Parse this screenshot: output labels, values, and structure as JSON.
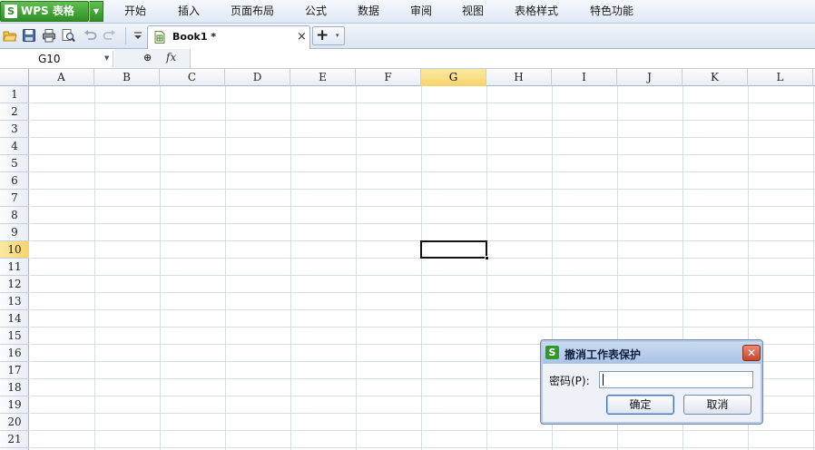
{
  "app": {
    "name": "WPS 表格",
    "logo_letter": "S"
  },
  "menu": {
    "items": [
      "开始",
      "插入",
      "页面布局",
      "公式",
      "数据",
      "审阅",
      "视图",
      "表格样式",
      "特色功能"
    ]
  },
  "toolbar": {
    "icons": [
      "open-folder-icon",
      "save-icon",
      "print-icon",
      "print-preview-icon",
      "undo-icon",
      "redo-icon",
      "customize-dropdown-icon"
    ]
  },
  "tabs": [
    {
      "label": "Book1 *",
      "close_glyph": "×",
      "active": true
    }
  ],
  "new_tab": {
    "glyph": "+",
    "dropdown_glyph": "▾"
  },
  "formula_bar": {
    "name_box": "G10",
    "zoom_glyph": "⊕",
    "fx_label": "fx",
    "formula": ""
  },
  "sheet": {
    "columns": [
      "A",
      "B",
      "C",
      "D",
      "E",
      "F",
      "G",
      "H",
      "I",
      "J",
      "K",
      "L"
    ],
    "rows": [
      "1",
      "2",
      "3",
      "4",
      "5",
      "6",
      "7",
      "8",
      "9",
      "10",
      "11",
      "12",
      "13",
      "14",
      "15",
      "16",
      "17",
      "18",
      "19",
      "20",
      "21"
    ],
    "active_cell": "G10",
    "active_column": "G",
    "active_row": "10",
    "header_highlight_color": "#f7d36a"
  },
  "dialog": {
    "title": "撤消工作表保护",
    "logo_letter": "S",
    "close_glyph": "✕",
    "password_label": "密码(P):",
    "password_value": "",
    "ok_label": "确定",
    "cancel_label": "取消"
  },
  "colors": {
    "app_button": "#2f8f27",
    "grid_line": "#d8dde5",
    "dialog_title": "#a9c3e6"
  }
}
